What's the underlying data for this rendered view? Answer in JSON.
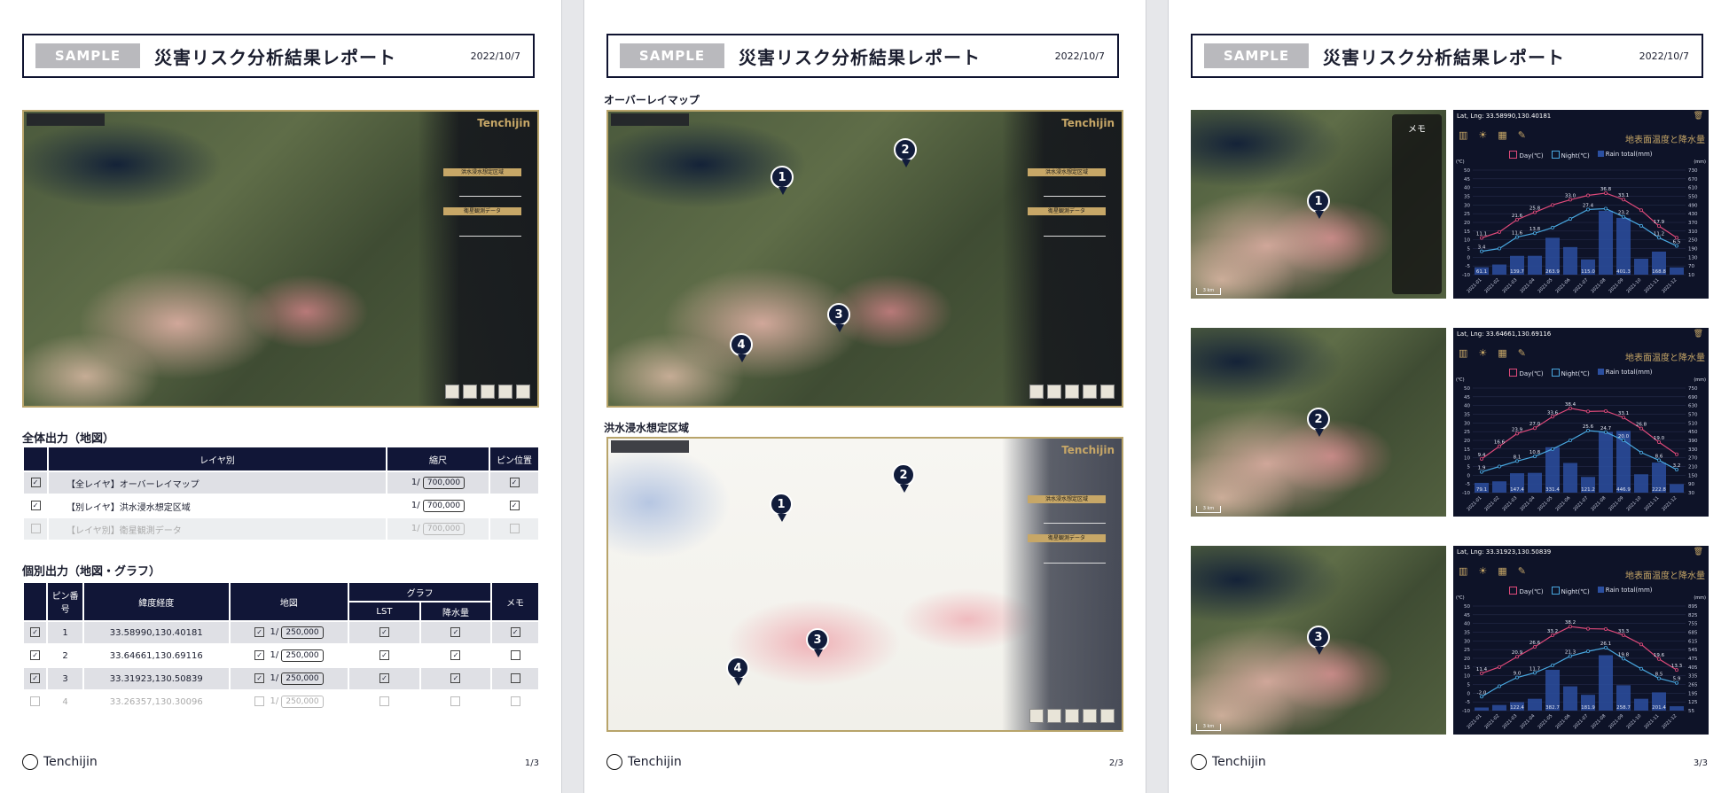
{
  "header": {
    "sample": "SAMPLE",
    "title": "災害リスク分析結果レポート",
    "date": "2022/10/7"
  },
  "brand": {
    "name": "Tenchijin"
  },
  "map_panel": {
    "layer1_label": "洪水浸水想定区域",
    "layer2_label": "衛星観測データ"
  },
  "page1": {
    "page_no": "1/3",
    "section_all": "全体出力（地図）",
    "section_individual": "個別出力（地図・グラフ）",
    "all_table": {
      "headers": [
        "レイヤ別",
        "縮尺",
        "ピン位置"
      ],
      "rows": [
        {
          "label": "【全レイヤ】オーバーレイマップ",
          "scale_prefix": "1/",
          "scale": "700,000"
        },
        {
          "label": "【別レイヤ】洪水浸水想定区域",
          "scale_prefix": "1/",
          "scale": "700,000"
        },
        {
          "label": "【レイヤ別】衛星観測データ",
          "scale_prefix": "1/",
          "scale": "700,000"
        }
      ]
    },
    "ind_table": {
      "headers": {
        "pin_no": "ピン番号",
        "latlng": "緯度経度",
        "map": "地図",
        "graph": "グラフ",
        "lst": "LST",
        "rain": "降水量",
        "memo": "メモ"
      },
      "rows": [
        {
          "no": "1",
          "latlng": "33.58990,130.40181",
          "scale_prefix": "1/",
          "scale": "250,000"
        },
        {
          "no": "2",
          "latlng": "33.64661,130.69116",
          "scale_prefix": "1/",
          "scale": "250,000"
        },
        {
          "no": "3",
          "latlng": "33.31923,130.50839",
          "scale_prefix": "1/",
          "scale": "250,000"
        },
        {
          "no": "4",
          "latlng": "33.26357,130.30096",
          "scale_prefix": "1/",
          "scale": "250,000"
        }
      ]
    }
  },
  "page2": {
    "page_no": "2/3",
    "overlay_title": "オーバーレイマップ",
    "flood_title": "洪水浸水想定区域",
    "pins": [
      "1",
      "2",
      "3",
      "4"
    ]
  },
  "page3": {
    "page_no": "3/3",
    "memo_label": "メモ",
    "scalebar": "3 km",
    "chart_title": "地表面温度と降水量",
    "panels": [
      {
        "pin": "1",
        "latlng": "Lat, Lng: 33.58990,130.40181"
      },
      {
        "pin": "2",
        "latlng": "Lat, Lng: 33.64661,130.69116"
      },
      {
        "pin": "3",
        "latlng": "Lat, Lng: 33.31923,130.50839"
      }
    ]
  },
  "chart_data": [
    {
      "type": "bar",
      "categories": [
        "2021-01",
        "2021-02",
        "2021-03",
        "2021-04",
        "2021-05",
        "2021-06",
        "2021-07",
        "2021-08",
        "2021-09",
        "2021-10",
        "2021-11",
        "2021-12"
      ],
      "y_left_label": "(℃)",
      "y_right_label": "(mm)",
      "ylim_left": [
        -10,
        50
      ],
      "ylim_right": [
        10,
        730
      ],
      "y_left_ticks": [
        "50",
        "45",
        "40",
        "35",
        "30",
        "25",
        "20",
        "15",
        "10",
        "5",
        "0",
        "-5",
        "-10"
      ],
      "y_right_ticks": [
        "730",
        "670",
        "610",
        "550",
        "490",
        "430",
        "370",
        "310",
        "250",
        "190",
        "130",
        "70",
        "10"
      ],
      "legend": [
        "Day(℃)",
        "Night(℃)",
        "Rain total(mm)"
      ],
      "series": [
        {
          "name": "Day(℃)",
          "color": "#e04a7a",
          "values": [
            11.1,
            14.5,
            21.6,
            25.8,
            30.0,
            33.0,
            35.5,
            36.8,
            33.1,
            27.0,
            17.9,
            11.2
          ],
          "labels": [
            "11.1",
            "",
            "21.6",
            "25.8",
            "",
            "33.0",
            "",
            "36.8",
            "33.1",
            "",
            "17.9",
            ""
          ]
        },
        {
          "name": "Night(℃)",
          "color": "#49a8e0",
          "values": [
            3.4,
            5.0,
            11.6,
            13.8,
            17.0,
            22.0,
            27.4,
            27.9,
            23.2,
            18.0,
            11.2,
            6.5
          ],
          "labels": [
            "3.4",
            "",
            "11.6",
            "13.8",
            "",
            "",
            "27.4",
            "",
            "23.2",
            "",
            "11.2",
            "6.5"
          ]
        },
        {
          "name": "Rain total(mm)",
          "color": "#2b4fa0",
          "values": [
            61.1,
            80,
            139.7,
            140,
            263.9,
            200,
            115.0,
            450,
            401.3,
            120,
            168.8,
            60
          ],
          "labels": [
            "61.1",
            "",
            "139.7",
            "",
            "263.9",
            "",
            "115.0",
            "",
            "401.3",
            "",
            "168.8",
            ""
          ]
        }
      ]
    },
    {
      "type": "bar",
      "categories": [
        "2021-01",
        "2021-02",
        "2021-03",
        "2021-04",
        "2021-05",
        "2021-06",
        "2021-07",
        "2021-08",
        "2021-09",
        "2021-10",
        "2021-11",
        "2021-12"
      ],
      "y_left_label": "(℃)",
      "y_right_label": "(mm)",
      "ylim_left": [
        -10,
        50
      ],
      "ylim_right": [
        10,
        750
      ],
      "y_left_ticks": [
        "50",
        "45",
        "40",
        "35",
        "30",
        "25",
        "20",
        "15",
        "10",
        "5",
        "0",
        "-5",
        "-10"
      ],
      "y_right_ticks": [
        "750",
        "690",
        "630",
        "570",
        "510",
        "450",
        "390",
        "330",
        "270",
        "210",
        "150",
        "90",
        "30"
      ],
      "legend": [
        "Day(℃)",
        "Night(℃)",
        "Rain total(mm)"
      ],
      "series": [
        {
          "name": "Day(℃)",
          "color": "#e04a7a",
          "values": [
            9.4,
            16.6,
            23.9,
            27.0,
            33.6,
            38.4,
            36.6,
            36.8,
            33.1,
            26.8,
            19.0,
            12.0
          ],
          "labels": [
            "9.4",
            "16.6",
            "23.9",
            "27.0",
            "33.6",
            "38.4",
            "",
            "",
            "33.1",
            "26.8",
            "19.0",
            ""
          ]
        },
        {
          "name": "Night(℃)",
          "color": "#49a8e0",
          "values": [
            1.9,
            5.0,
            8.1,
            10.8,
            15.0,
            20.0,
            25.6,
            24.7,
            20.0,
            13.0,
            8.6,
            3.2
          ],
          "labels": [
            "1.9",
            "",
            "8.1",
            "10.8",
            "",
            "",
            "25.6",
            "24.7",
            "20.0",
            "",
            "8.6",
            "3.2"
          ]
        },
        {
          "name": "Rain total(mm)",
          "color": "#2b4fa0",
          "values": [
            79.1,
            90,
            147.4,
            150,
            331.4,
            220,
            121.2,
            440,
            446.9,
            140,
            222.8,
            70
          ],
          "labels": [
            "79.1",
            "",
            "147.4",
            "",
            "331.4",
            "",
            "121.2",
            "",
            "446.9",
            "",
            "222.8",
            ""
          ]
        }
      ]
    },
    {
      "type": "bar",
      "categories": [
        "2021-01",
        "2021-02",
        "2021-03",
        "2021-04",
        "2021-05",
        "2021-06",
        "2021-07",
        "2021-08",
        "2021-09",
        "2021-10",
        "2021-11",
        "2021-12"
      ],
      "y_left_label": "(℃)",
      "y_right_label": "(mm)",
      "ylim_left": [
        -10,
        50
      ],
      "ylim_right": [
        55,
        895
      ],
      "y_left_ticks": [
        "50",
        "45",
        "40",
        "35",
        "30",
        "25",
        "20",
        "15",
        "10",
        "5",
        "0",
        "-5",
        "-10"
      ],
      "y_right_ticks": [
        "895",
        "825",
        "755",
        "685",
        "615",
        "545",
        "475",
        "405",
        "335",
        "265",
        "195",
        "125",
        "55"
      ],
      "legend": [
        "Day(℃)",
        "Night(℃)",
        "Rain total(mm)"
      ],
      "series": [
        {
          "name": "Day(℃)",
          "color": "#e04a7a",
          "values": [
            11.4,
            15.0,
            20.9,
            26.6,
            33.2,
            38.2,
            37.0,
            36.8,
            33.3,
            28.0,
            19.6,
            13.3
          ],
          "labels": [
            "11.4",
            "",
            "20.9",
            "26.6",
            "33.2",
            "38.2",
            "",
            "",
            "33.3",
            "",
            "19.6",
            "13.3"
          ]
        },
        {
          "name": "Night(℃)",
          "color": "#49a8e0",
          "values": [
            -2.0,
            4.0,
            9.0,
            11.7,
            16.0,
            21.3,
            24.0,
            26.1,
            19.8,
            14.0,
            8.5,
            5.9
          ],
          "labels": [
            "-2.0",
            "",
            "9.0",
            "11.7",
            "",
            "21.3",
            "",
            "26.1",
            "19.8",
            "",
            "8.5",
            "5.9"
          ]
        },
        {
          "name": "Rain total(mm)",
          "color": "#2b4fa0",
          "values": [
            80,
            100,
            122.4,
            150,
            382.7,
            250,
            181.9,
            500,
            258.7,
            150,
            201.4,
            90
          ],
          "labels": [
            "",
            "",
            "122.4",
            "",
            "382.7",
            "",
            "181.9",
            "",
            "258.7",
            "",
            "201.4",
            ""
          ]
        }
      ]
    }
  ]
}
